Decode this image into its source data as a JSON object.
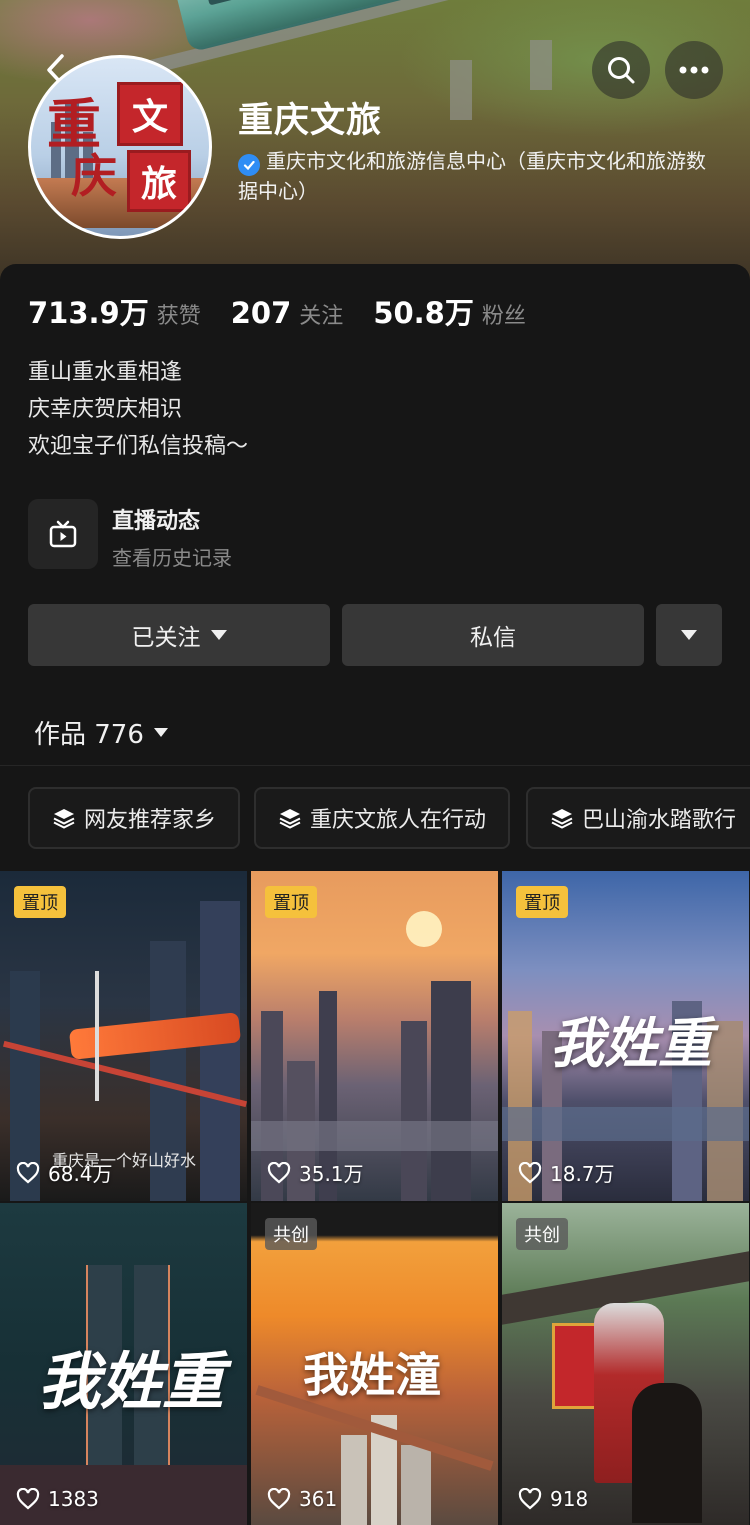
{
  "header": {
    "name": "重庆文旅",
    "verified_text": "重庆市文化和旅游信息中心（重庆市文化和旅游数据中心）",
    "avatar_chars": [
      "文",
      "旅",
      "重",
      "庆"
    ]
  },
  "stats": [
    {
      "num": "713.9万",
      "label": "获赞"
    },
    {
      "num": "207",
      "label": "关注"
    },
    {
      "num": "50.8万",
      "label": "粉丝"
    }
  ],
  "bio": [
    "重山重水重相逢",
    "庆幸庆贺庆相识",
    "欢迎宝子们私信投稿～"
  ],
  "live": {
    "title": "直播动态",
    "subtitle": "查看历史记录"
  },
  "actions": {
    "follow": "已关注",
    "message": "私信"
  },
  "works": {
    "label": "作品 776"
  },
  "collections": [
    "网友推荐家乡",
    "重庆文旅人在行动",
    "巴山渝水踏歌行"
  ],
  "videos": [
    {
      "badge": "置顶",
      "likes": "68.4万",
      "caption": "重庆是一个好山好水"
    },
    {
      "badge": "置顶",
      "likes": "35.1万"
    },
    {
      "badge": "置顶",
      "likes": "18.7万",
      "caption": "我姓重"
    },
    {
      "likes": "1383",
      "caption": "我姓重"
    },
    {
      "badge": "共创",
      "likes": "361",
      "caption": "我姓潼"
    },
    {
      "badge": "共创",
      "likes": "918"
    }
  ],
  "colors": {
    "background": "#161616",
    "pin_badge": "#f5c13c",
    "verified": "#2f8df5",
    "button": "#373737"
  }
}
